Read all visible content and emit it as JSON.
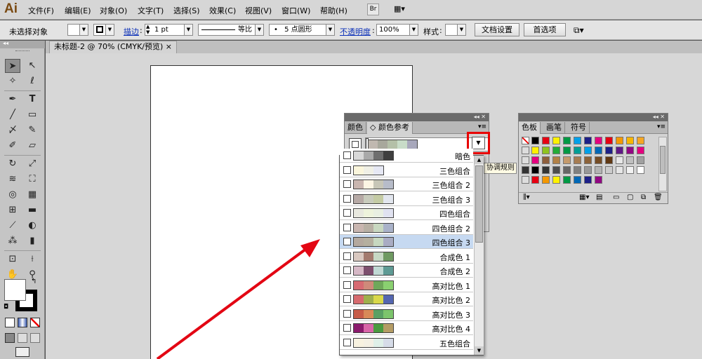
{
  "app": {
    "logo": "Ai"
  },
  "menu": [
    "文件(F)",
    "编辑(E)",
    "对象(O)",
    "文字(T)",
    "选择(S)",
    "效果(C)",
    "视图(V)",
    "窗口(W)",
    "帮助(H)"
  ],
  "menubar_buttons": {
    "bridge": "Br",
    "arrange": "▦▾"
  },
  "control_bar": {
    "selection": "未选择对象",
    "stroke_label": "描边",
    "stroke_value": "1 pt",
    "profile_value": "等比",
    "brush_value": "5 点圆形",
    "opacity_label": "不透明度",
    "opacity_value": "100%",
    "style_label": "样式",
    "doc_setup_button": "文档设置",
    "prefs_button": "首选项"
  },
  "document_tab": {
    "title": "未标题-2 @ 70% (CMYK/预览)",
    "close": "×"
  },
  "color_guide_panel": {
    "tabs": [
      "颜色",
      "颜色参考"
    ],
    "tooltip": "协调规则"
  },
  "swatches_panel": {
    "tabs": [
      "色板",
      "画笔",
      "符号"
    ]
  },
  "harmony_rules": [
    {
      "label": "暗色",
      "colors": [
        "#d8d8d8",
        "#a9a9a9",
        "#6e6e6e",
        "#3f3f3f"
      ]
    },
    {
      "label": "三色组合",
      "colors": [
        "#fbf6dc",
        "#f0f0e6",
        "#e6e8f4"
      ]
    },
    {
      "label": "三色组合 2",
      "colors": [
        "#c9b6b0",
        "#fcf5e4",
        "#c7c6b7",
        "#b7bcc9"
      ]
    },
    {
      "label": "三色组合 3",
      "colors": [
        "#b6a9a5",
        "#c8cbbc",
        "#c4cba4",
        "#e2e6ee"
      ]
    },
    {
      "label": "四色组合",
      "colors": [
        "#e8e8df",
        "#eef3dc",
        "#e9efe2",
        "#e0e2f0"
      ]
    },
    {
      "label": "四色组合 2",
      "colors": [
        "#c9b6b0",
        "#b8b0a4",
        "#c8d8c0",
        "#a9b2c9"
      ]
    },
    {
      "label": "四色组合 3",
      "colors": [
        "#b4a89e",
        "#b5af9f",
        "#c7d8c0",
        "#a9acc3"
      ]
    },
    {
      "label": "合成色 1",
      "colors": [
        "#d9c8c0",
        "#a37a6e",
        "#c7d8c4",
        "#6f9a62"
      ]
    },
    {
      "label": "合成色 2",
      "colors": [
        "#d6b8c6",
        "#7d4f6e",
        "#c0d9d4",
        "#5e9a94"
      ]
    },
    {
      "label": "高对比色 1",
      "colors": [
        "#d76a72",
        "#cf8a7a",
        "#6fa85a",
        "#8ad070"
      ]
    },
    {
      "label": "高对比色 2",
      "colors": [
        "#d66a6e",
        "#9fb04c",
        "#d9d84a",
        "#5466b0"
      ]
    },
    {
      "label": "高对比色 3",
      "colors": [
        "#c75c48",
        "#d88a58",
        "#5aa064",
        "#7cc46c"
      ]
    },
    {
      "label": "高对比色 4",
      "colors": [
        "#8a1a6c",
        "#d866a8",
        "#4a9a40",
        "#b49c64"
      ]
    },
    {
      "label": "五色组合",
      "colors": [
        "#f8f2e0",
        "#f4f0e4",
        "#dff0e8",
        "#d6dce8"
      ]
    }
  ],
  "current_group_colors": [
    "#c0b8b0",
    "#a8a89c",
    "#b4c0a8",
    "#c8dcc8",
    "#a8a8bc"
  ],
  "swatch_colors": {
    "row1": [
      "#000000",
      "#e60012",
      "#fff100",
      "#009944",
      "#00a0e9",
      "#1d2088",
      "#e4007f",
      "#e60012",
      "#f39800",
      "#f8b500",
      "#f5a623"
    ],
    "row2": [
      "#fff100",
      "#8fc31f",
      "#22ac38",
      "#009944",
      "#009e96",
      "#00a0e9",
      "#0068b7",
      "#1d2088",
      "#601986",
      "#920783",
      "#e4007f"
    ],
    "row3": [
      "#e4007f",
      "#8e5e3c",
      "#b28146",
      "#c49a6c",
      "#a67c52",
      "#8c6239",
      "#754c24",
      "#603813",
      "#e8e8e8",
      "#c0c0c0",
      "#a0a0a0"
    ],
    "row4": [
      "#000000",
      "#333333",
      "#4d4d4d",
      "#666666",
      "#808080",
      "#999999",
      "#b3b3b3",
      "#cccccc",
      "#e6e6e6",
      "#f2f2f2",
      "#ffffff"
    ],
    "row5": [
      "#e60012",
      "#f39800",
      "#fff100",
      "#009944",
      "#0068b7",
      "#1d2088",
      "#920783"
    ]
  },
  "colors": {
    "accent_red": "#e80000",
    "highlight": "#c6d9f1",
    "arrow": "#e30613"
  }
}
